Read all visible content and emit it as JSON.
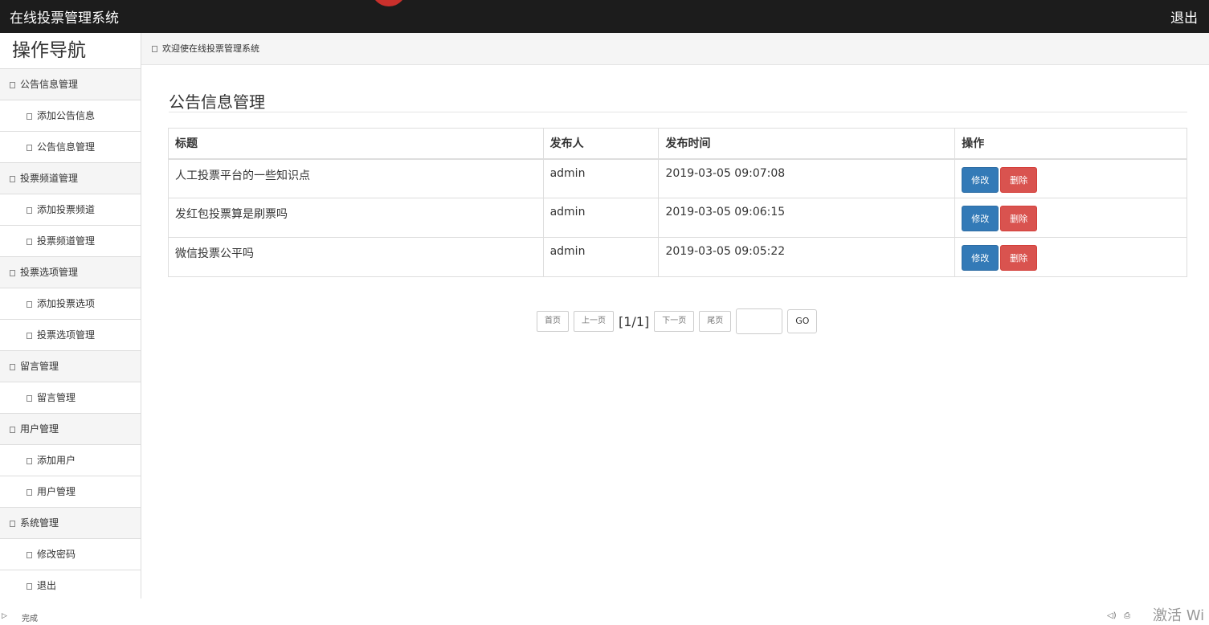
{
  "header": {
    "title": "在线投票管理系统",
    "logout_label": "退出"
  },
  "sidebar": {
    "title": "操作导航",
    "groups": [
      {
        "label": "公告信息管理",
        "items": [
          "添加公告信息",
          "公告信息管理"
        ]
      },
      {
        "label": "投票频道管理",
        "items": [
          "添加投票频道",
          "投票频道管理"
        ]
      },
      {
        "label": "投票选项管理",
        "items": [
          "添加投票选项",
          "投票选项管理"
        ]
      },
      {
        "label": "留言管理",
        "items": [
          "留言管理"
        ]
      },
      {
        "label": "用户管理",
        "items": [
          "添加用户",
          "用户管理"
        ]
      },
      {
        "label": "系统管理",
        "items": [
          "修改密码",
          "退出"
        ]
      }
    ]
  },
  "breadcrumb": {
    "text": "欢迎使在线投票管理系统"
  },
  "main": {
    "heading": "公告信息管理",
    "table": {
      "columns": [
        "标题",
        "发布人",
        "发布时间",
        "操作"
      ],
      "rows": [
        {
          "title": "人工投票平台的一些知识点",
          "publisher": "admin",
          "time": "2019-03-05 09:07:08"
        },
        {
          "title": "发红包投票算是刷票吗",
          "publisher": "admin",
          "time": "2019-03-05 09:06:15"
        },
        {
          "title": "微信投票公平吗",
          "publisher": "admin",
          "time": "2019-03-05 09:05:22"
        }
      ],
      "edit_label": "修改",
      "delete_label": "删除"
    },
    "pagination": {
      "first": "首页",
      "prev": "上一页",
      "info": "[1/1]",
      "next": "下一页",
      "last": "尾页",
      "input_value": "",
      "go": "GO"
    }
  },
  "statusbar": {
    "text": "完成",
    "watermark": "激活 Wi"
  },
  "colors": {
    "topbar": "#1c1c1c",
    "edit": "#337ab7",
    "delete": "#d9534f"
  }
}
